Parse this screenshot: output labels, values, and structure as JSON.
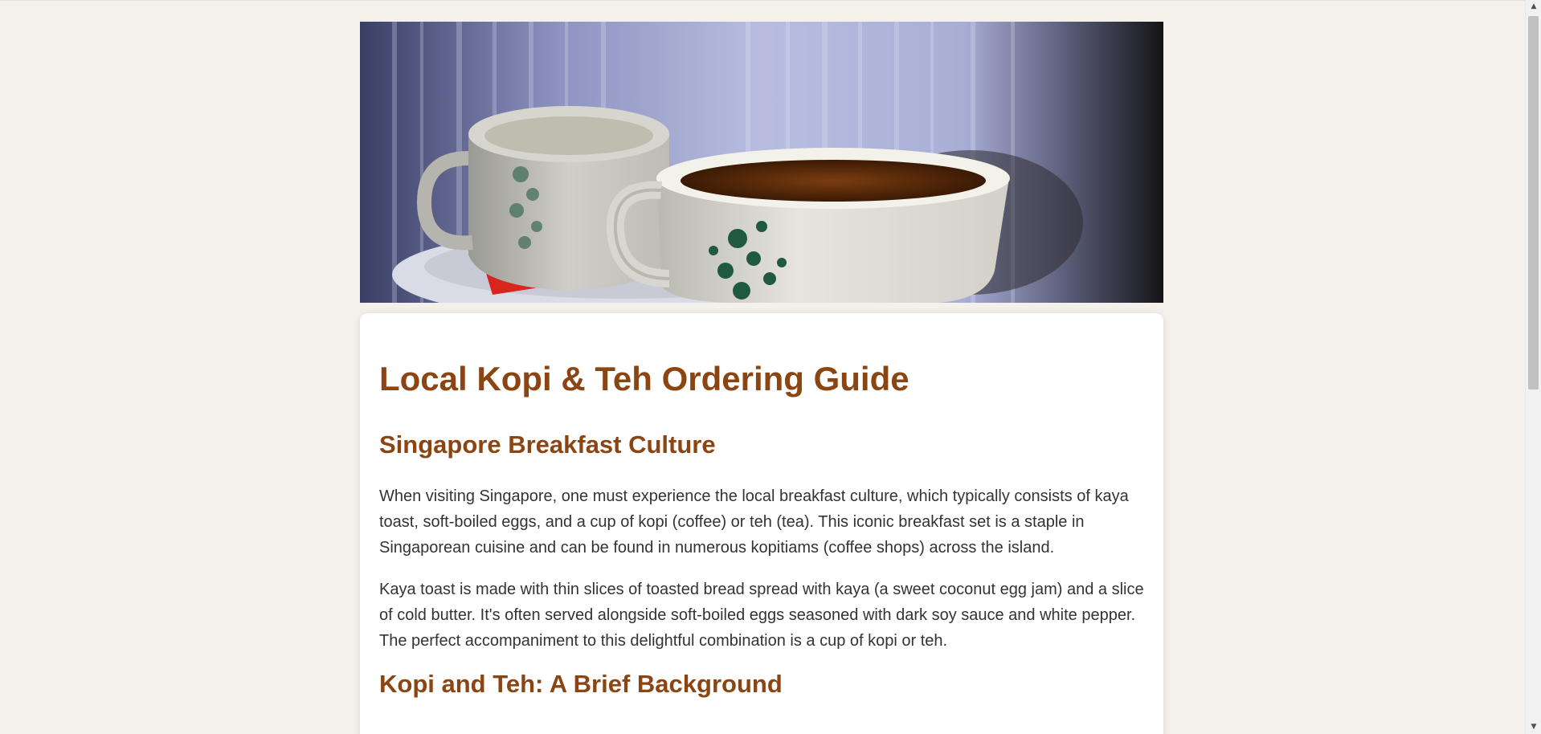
{
  "hero": {
    "image_icon": "coffee-cups-photo"
  },
  "article": {
    "title": "Local Kopi & Teh Ordering Guide",
    "section1_heading": "Singapore Breakfast Culture",
    "paragraph1": "When visiting Singapore, one must experience the local breakfast culture, which typically consists of kaya toast, soft-boiled eggs, and a cup of kopi (coffee) or teh (tea). This iconic breakfast set is a staple in Singaporean cuisine and can be found in numerous kopitiams (coffee shops) across the island.",
    "paragraph2": "Kaya toast is made with thin slices of toasted bread spread with kaya (a sweet coconut egg jam) and a slice of cold butter. It's often served alongside soft-boiled eggs seasoned with dark soy sauce and white pepper. The perfect accompaniment to this delightful combination is a cup of kopi or teh.",
    "section2_heading": "Kopi and Teh: A Brief Background"
  },
  "scrollbar": {
    "up_icon": "scroll-up-arrow-icon",
    "down_icon": "scroll-down-arrow-icon"
  },
  "colors": {
    "page_background": "#f4f1ea",
    "heading": "#8b4513",
    "body_text": "#333333",
    "card_background": "#ffffff"
  }
}
